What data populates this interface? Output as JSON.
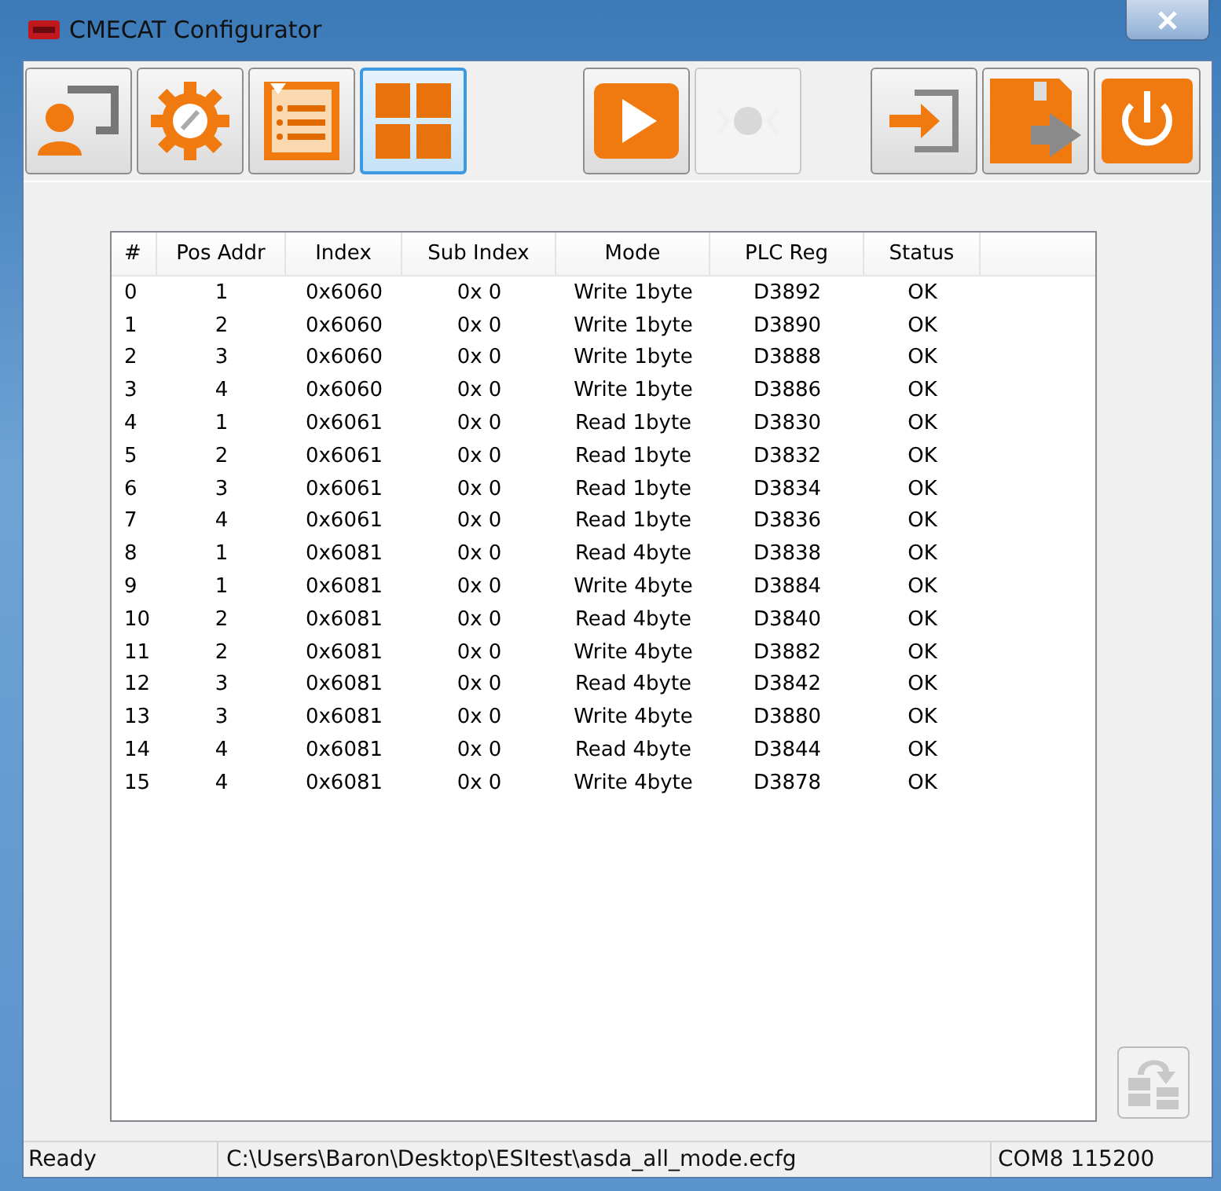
{
  "window": {
    "title": "CMECAT Configurator"
  },
  "toolbar": [
    {
      "kind": "connect",
      "selected": false,
      "disabled": false
    },
    {
      "kind": "settings",
      "selected": false,
      "disabled": false
    },
    {
      "kind": "list",
      "selected": false,
      "disabled": false
    },
    {
      "kind": "grid",
      "selected": true,
      "disabled": false
    },
    {
      "kind": "play",
      "selected": false,
      "disabled": false
    },
    {
      "kind": "record",
      "selected": false,
      "disabled": true
    },
    {
      "kind": "import",
      "selected": false,
      "disabled": false
    },
    {
      "kind": "save",
      "selected": false,
      "disabled": false
    },
    {
      "kind": "power",
      "selected": false,
      "disabled": false
    }
  ],
  "table": {
    "columns": [
      "#",
      "Pos Addr",
      "Index",
      "Sub Index",
      "Mode",
      "PLC Reg",
      "Status"
    ],
    "rows": [
      [
        "0",
        "1",
        "0x6060",
        "0x 0",
        "Write 1byte",
        "D3892",
        "OK"
      ],
      [
        "1",
        "2",
        "0x6060",
        "0x 0",
        "Write 1byte",
        "D3890",
        "OK"
      ],
      [
        "2",
        "3",
        "0x6060",
        "0x 0",
        "Write 1byte",
        "D3888",
        "OK"
      ],
      [
        "3",
        "4",
        "0x6060",
        "0x 0",
        "Write 1byte",
        "D3886",
        "OK"
      ],
      [
        "4",
        "1",
        "0x6061",
        "0x 0",
        "Read 1byte",
        "D3830",
        "OK"
      ],
      [
        "5",
        "2",
        "0x6061",
        "0x 0",
        "Read 1byte",
        "D3832",
        "OK"
      ],
      [
        "6",
        "3",
        "0x6061",
        "0x 0",
        "Read 1byte",
        "D3834",
        "OK"
      ],
      [
        "7",
        "4",
        "0x6061",
        "0x 0",
        "Read 1byte",
        "D3836",
        "OK"
      ],
      [
        "8",
        "1",
        "0x6081",
        "0x 0",
        "Read 4byte",
        "D3838",
        "OK"
      ],
      [
        "9",
        "1",
        "0x6081",
        "0x 0",
        "Write 4byte",
        "D3884",
        "OK"
      ],
      [
        "10",
        "2",
        "0x6081",
        "0x 0",
        "Read 4byte",
        "D3840",
        "OK"
      ],
      [
        "11",
        "2",
        "0x6081",
        "0x 0",
        "Write 4byte",
        "D3882",
        "OK"
      ],
      [
        "12",
        "3",
        "0x6081",
        "0x 0",
        "Read 4byte",
        "D3842",
        "OK"
      ],
      [
        "13",
        "3",
        "0x6081",
        "0x 0",
        "Write 4byte",
        "D3880",
        "OK"
      ],
      [
        "14",
        "4",
        "0x6081",
        "0x 0",
        "Read 4byte",
        "D3844",
        "OK"
      ],
      [
        "15",
        "4",
        "0x6081",
        "0x 0",
        "Write 4byte",
        "D3878",
        "OK"
      ]
    ]
  },
  "side_button": {
    "disabled": true
  },
  "status_bar": [
    "Ready",
    "C:\\Users\\Baron\\Desktop\\ESItest\\asda_all_mode.ecfg",
    "COM8  115200"
  ]
}
